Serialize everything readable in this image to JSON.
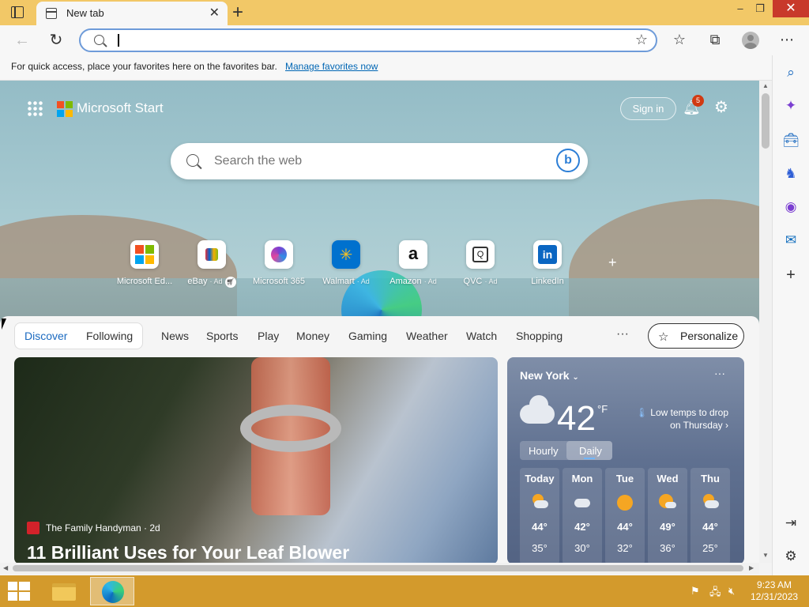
{
  "tab": {
    "title": "New tab"
  },
  "window": {
    "minimize": "–",
    "restore": "❐",
    "close": "✕"
  },
  "address_bar": {
    "value": "",
    "placeholder": ""
  },
  "favorites_bar": {
    "message": "For quick access, place your favorites here on the favorites bar.",
    "link": "Manage favorites now"
  },
  "start_page": {
    "brand": "Microsoft Start",
    "sign_in": "Sign in",
    "notification_count": "5",
    "search_placeholder": "Search the web",
    "bing_glyph": "b",
    "tiles": [
      {
        "label": "Microsoft Ed...",
        "ad": "",
        "icon": "microsoft-logo-icon"
      },
      {
        "label": "eBay",
        "ad": "· Ad",
        "icon": "ebay-bag-icon"
      },
      {
        "label": "Microsoft 365",
        "ad": "",
        "icon": "microsoft-365-icon"
      },
      {
        "label": "Walmart",
        "ad": "· Ad",
        "icon": "walmart-spark-icon"
      },
      {
        "label": "Amazon",
        "ad": "· Ad",
        "icon": "amazon-icon"
      },
      {
        "label": "QVC",
        "ad": "· Ad",
        "icon": "qvc-icon"
      },
      {
        "label": "LinkedIn",
        "ad": "",
        "icon": "linkedin-icon"
      }
    ]
  },
  "feed_nav": {
    "items": [
      "Discover",
      "Following",
      "News",
      "Sports",
      "Play",
      "Money",
      "Gaming",
      "Weather",
      "Watch",
      "Shopping"
    ],
    "more": "···",
    "personalize": "Personalize"
  },
  "hero": {
    "source": "The Family Handyman · 2d",
    "title": "11 Brilliant Uses for Your Leaf Blower"
  },
  "weather": {
    "city": "New York",
    "temp": "42",
    "unit": "°F",
    "alert": "Low temps to drop on Thursday",
    "toggle": [
      "Hourly",
      "Daily"
    ],
    "days": [
      {
        "name": "Today",
        "icon": "partly-cloudy-icon",
        "hi": "44°",
        "lo": "35°"
      },
      {
        "name": "Mon",
        "icon": "cloudy-icon",
        "hi": "42°",
        "lo": "30°"
      },
      {
        "name": "Tue",
        "icon": "sunny-icon",
        "hi": "44°",
        "lo": "32°"
      },
      {
        "name": "Wed",
        "icon": "partly-sunny-icon",
        "hi": "49°",
        "lo": "36°"
      },
      {
        "name": "Thu",
        "icon": "partly-cloudy-icon",
        "hi": "44°",
        "lo": "25°"
      }
    ]
  },
  "taskbar": {
    "time": "9:23 AM",
    "date": "12/31/2023"
  },
  "colors": {
    "titlebar": "#f2c867",
    "taskbar": "#d39a2c",
    "accent": "#1b6ac0",
    "close": "#c8392b",
    "badge": "#d13a12"
  }
}
